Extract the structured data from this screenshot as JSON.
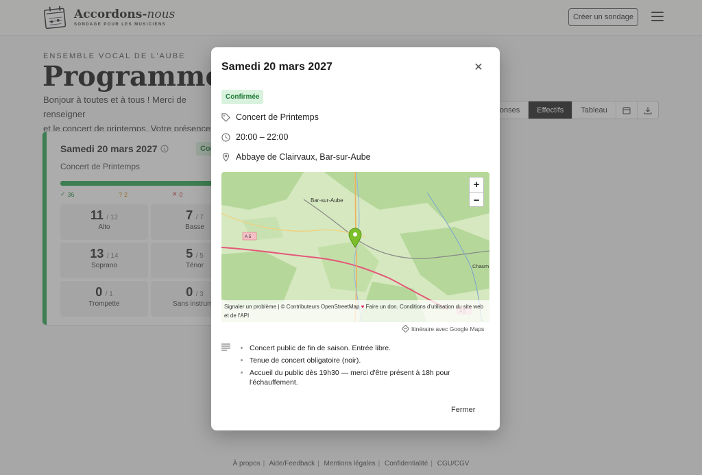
{
  "brand": {
    "name_main": "Accordons-",
    "name_italic": "nous",
    "tagline": "SONDAGE POUR LES MUSICIENS"
  },
  "header": {
    "create_label": "Créer un sondage"
  },
  "page": {
    "eyebrow": "ENSEMBLE VOCAL DE L'AUBE",
    "title": "Programme Pr",
    "intro_line1": "Bonjour à toutes et à tous ! Merci de renseigner",
    "intro_line2": "et le concert de printemps. Votre présence est"
  },
  "viewbar": {
    "responses": "réponses",
    "effectifs": "Effectifs",
    "tableau": "Tableau"
  },
  "card": {
    "date": "Samedi 20 mars 2027",
    "badge": "Conf",
    "name": "Concert de Printemps",
    "stats": {
      "yes": "36",
      "maybe": "2",
      "no": "0"
    },
    "voices": [
      {
        "num": "11",
        "tot": "/ 12",
        "label": "Alto"
      },
      {
        "num": "7",
        "tot": "/ 7",
        "label": "Basse"
      },
      {
        "num": "13",
        "tot": "/ 14",
        "label": "Soprano"
      },
      {
        "num": "5",
        "tot": "/ 5",
        "label": "Ténor"
      },
      {
        "num": "0",
        "tot": "/ 1",
        "label": "Trompette"
      },
      {
        "num": "0",
        "tot": "/ 3",
        "label": "Sans instrume"
      }
    ]
  },
  "modal": {
    "title": "Samedi 20 mars 2027",
    "status": "Confirmée",
    "event_name": "Concert de Printemps",
    "time": "20:00 – 22:00",
    "location": "Abbaye de Clairvaux, Bar-sur-Aube",
    "map": {
      "labels": {
        "town1": "Bar-sur-Aube",
        "road1": "A 5",
        "road2": "A 5",
        "town2": "Chaum"
      },
      "zoom_in": "+",
      "zoom_out": "−",
      "attribution_1": "Signaler un problème | © Contributeurs OpenStreetMap",
      "attribution_heart": "♥",
      "attribution_2": "Faire un don. Conditions d'utilisation",
      "attribution_3": "du site web et de l'API"
    },
    "itinerary": "Itinéraire avec Google Maps",
    "notes": [
      "Concert public de fin de saison. Entrée libre.",
      "Tenue de concert obligatoire (noir).",
      "Accueil du public dès 19h30 — merci d'être présent à 18h pour l'échauffement."
    ],
    "close_label": "Fermer"
  },
  "footer": {
    "links": [
      "À propos",
      "Aide/Feedback",
      "Mentions légales",
      "Confidentialité",
      "CGU/CGV"
    ]
  },
  "colors": {
    "accent_green": "#22a34a",
    "badge_bg": "#d9f2de",
    "badge_text": "#1d7a36",
    "pin": "#7cbf2a"
  }
}
